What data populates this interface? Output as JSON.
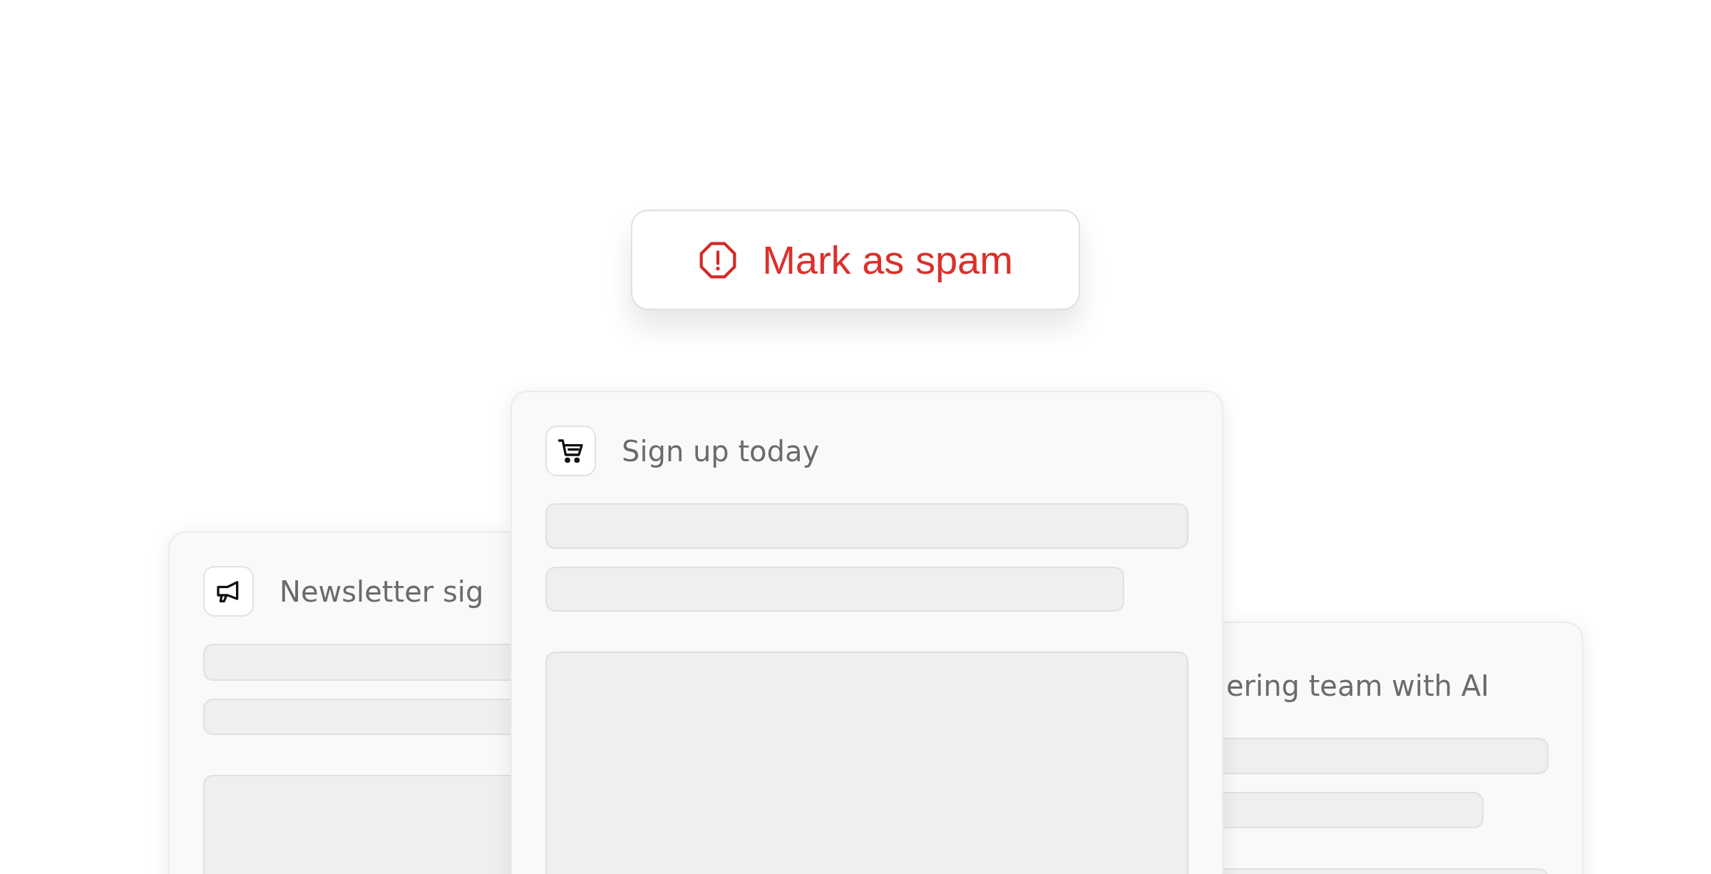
{
  "spam_button": {
    "label": "Mark as spam"
  },
  "cards": [
    {
      "title": "Newsletter sig"
    },
    {
      "title": "ering team with AI"
    },
    {
      "title": "Sign up today"
    }
  ]
}
